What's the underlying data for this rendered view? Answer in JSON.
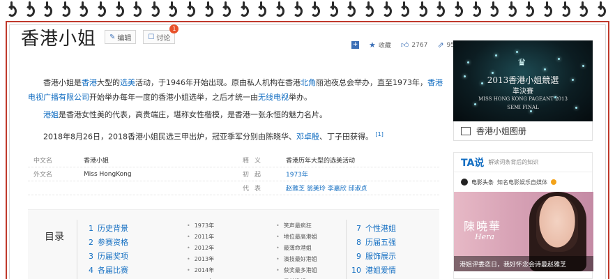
{
  "page": {
    "title": "香港小姐",
    "edit_label": "编辑",
    "discuss_label": "讨论",
    "discuss_badge": "1"
  },
  "toolbar": {
    "collect_label": "收藏",
    "like_count": "2767",
    "share_count": "95"
  },
  "intro": {
    "p1_a": "香港小姐是",
    "p1_link1": "香港",
    "p1_b": "大型的",
    "p1_link2": "选美",
    "p1_c": "活动，于1946年开始出现。原由私人机构在香港",
    "p1_link3": "北角",
    "p1_d": "丽池夜总会举办，直至1973年，",
    "p1_link4": "香港电视广播有限公司",
    "p1_e": "开始举办每年一度的香港小姐选举，之后才统一由",
    "p1_link5": "无线电视",
    "p1_f": "举办。",
    "p2_link": "港姐",
    "p2_text": "是香港女性美的代表，高贵端庄，堪称女性楷模，是香港一张永恒的魅力名片。",
    "p3_text": "2018年8月26日，2018香港小姐民选三甲出炉，冠亚季军分别由陈晓华、",
    "p3_link": "邓卓殷",
    "p3_text2": "、丁子田获得。",
    "p3_ref": "[1]"
  },
  "info": {
    "rows": [
      {
        "k": "中文名",
        "v": "香港小姐",
        "k2": "释义",
        "v2": "香港历年大型的选美活动"
      },
      {
        "k": "外文名",
        "v": "Miss HongKong",
        "k2": "初起",
        "v2": "1973年"
      },
      {
        "k": "",
        "v": "",
        "k2": "代表",
        "v2": "赵雅芝 翁美玲 李嘉欣 邱淑贞"
      }
    ]
  },
  "toc": {
    "label": "目录",
    "col1": [
      {
        "num": "1",
        "label": "历史背景"
      },
      {
        "num": "2",
        "label": "参赛资格"
      },
      {
        "num": "3",
        "label": "历届奖项"
      },
      {
        "num": "4",
        "label": "各届比赛"
      }
    ],
    "col2": [
      "1973年",
      "2011年",
      "2012年",
      "2013年",
      "2014年",
      "2015年"
    ],
    "col3": [
      "笑声最疯狂",
      "地位最高港姐",
      "最薄命港姐",
      "演技最好港姐",
      "获奖最多港姐",
      "最美港姐"
    ],
    "col4": [
      {
        "num": "7",
        "label": "个性港姐"
      },
      {
        "num": "8",
        "label": "历届五强"
      },
      {
        "num": "9",
        "label": "服饰展示"
      },
      {
        "num": "10",
        "label": "港姐爱情"
      }
    ]
  },
  "sidebar": {
    "image_line1": "2013香港小姐競選",
    "image_line2": "準決賽",
    "image_line3": "MISS HONG KONG PAGEANT 2013",
    "image_line4": "SEMI FINAL",
    "gallery_label": "香港小姐图册",
    "ta_logo": "TA说",
    "ta_sub": "解读词条背后的知识",
    "ta_source": "电影头条",
    "ta_source_desc": "知名电影娱乐自媒体",
    "ta_img_name": "陳曉華",
    "ta_img_name2": "Hera",
    "ta_caption": "港姐评委恋日，我好怀念会诗曼赵雅芝"
  }
}
